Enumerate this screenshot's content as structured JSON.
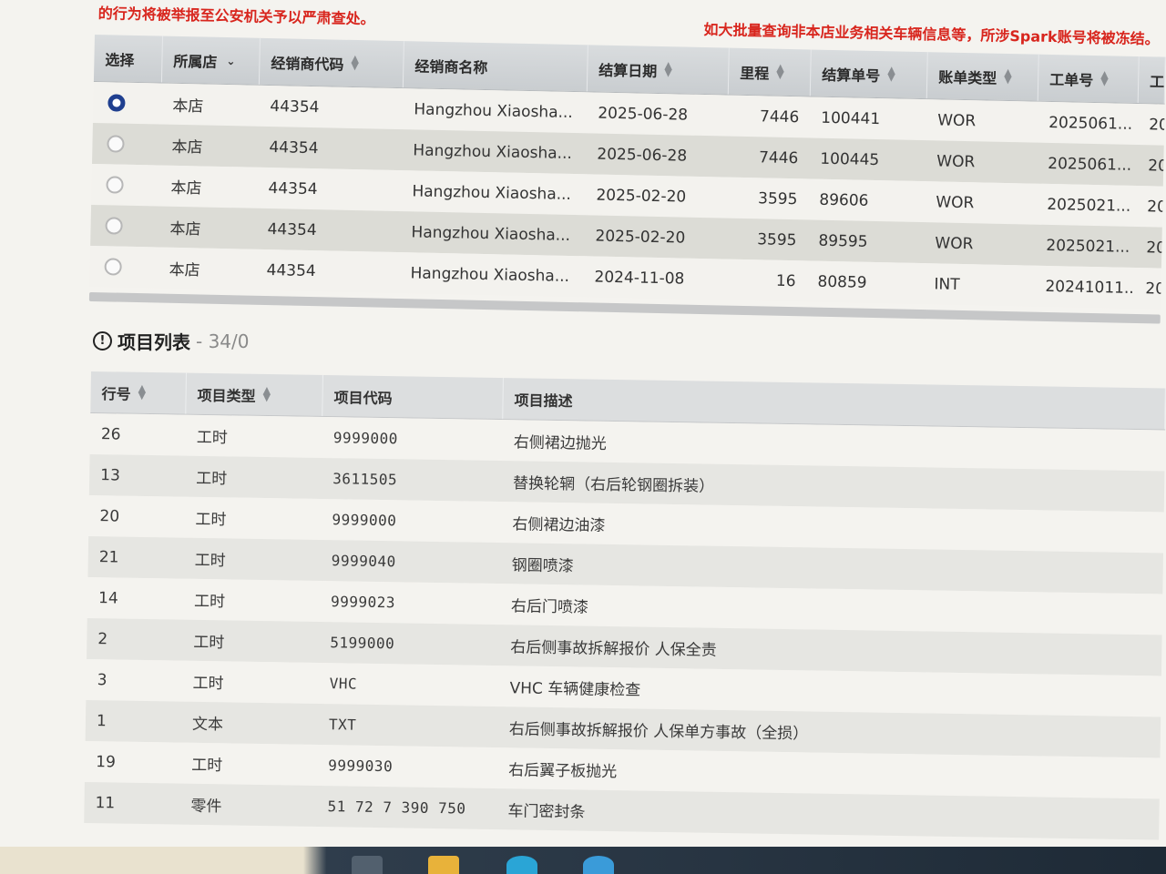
{
  "banner": {
    "warning_left": "的行为将被举报至公安机关予以严肃查处。",
    "warning_right": "如大批量查询非本店业务相关车辆信息等，所涉Spark账号将被冻结。"
  },
  "dealer_table": {
    "columns": [
      "选择",
      "所属店",
      "经销商代码",
      "经销商名称",
      "结算日期",
      "里程",
      "结算单号",
      "账单类型",
      "工单号",
      "工"
    ],
    "rows": [
      {
        "selected": true,
        "store": "本店",
        "code": "44354",
        "name": "Hangzhou Xiaosha...",
        "date": "2025-06-28",
        "mileage": "7446",
        "settle_no": "100441",
        "bill_type": "WOR",
        "order_no": "2025061...",
        "extra": "20"
      },
      {
        "selected": false,
        "store": "本店",
        "code": "44354",
        "name": "Hangzhou Xiaosha...",
        "date": "2025-06-28",
        "mileage": "7446",
        "settle_no": "100445",
        "bill_type": "WOR",
        "order_no": "2025061...",
        "extra": "20"
      },
      {
        "selected": false,
        "store": "本店",
        "code": "44354",
        "name": "Hangzhou Xiaosha...",
        "date": "2025-02-20",
        "mileage": "3595",
        "settle_no": "89606",
        "bill_type": "WOR",
        "order_no": "2025021...",
        "extra": "20"
      },
      {
        "selected": false,
        "store": "本店",
        "code": "44354",
        "name": "Hangzhou Xiaosha...",
        "date": "2025-02-20",
        "mileage": "3595",
        "settle_no": "89595",
        "bill_type": "WOR",
        "order_no": "2025021...",
        "extra": "20"
      },
      {
        "selected": false,
        "store": "本店",
        "code": "44354",
        "name": "Hangzhou Xiaosha...",
        "date": "2024-11-08",
        "mileage": "16",
        "settle_no": "80859",
        "bill_type": "INT",
        "order_no": "20241011...",
        "extra": "20"
      }
    ]
  },
  "items_section": {
    "title": "项目列表",
    "count": "- 34/0",
    "columns": [
      "行号",
      "项目类型",
      "项目代码",
      "项目描述"
    ],
    "rows": [
      {
        "line": "26",
        "type": "工时",
        "code": "9999000",
        "desc": "右侧裙边抛光"
      },
      {
        "line": "13",
        "type": "工时",
        "code": "3611505",
        "desc": "替换轮辋（右后轮钢圈拆装）"
      },
      {
        "line": "20",
        "type": "工时",
        "code": "9999000",
        "desc": "右侧裙边油漆"
      },
      {
        "line": "21",
        "type": "工时",
        "code": "9999040",
        "desc": "钢圈喷漆"
      },
      {
        "line": "14",
        "type": "工时",
        "code": "9999023",
        "desc": "右后门喷漆"
      },
      {
        "line": "2",
        "type": "工时",
        "code": "5199000",
        "desc": "右后侧事故拆解报价   人保全责"
      },
      {
        "line": "3",
        "type": "工时",
        "code": "VHC",
        "desc": "VHC 车辆健康检查"
      },
      {
        "line": "1",
        "type": "文本",
        "code": "TXT",
        "desc": "右后侧事故拆解报价   人保单方事故（全损）"
      },
      {
        "line": "19",
        "type": "工时",
        "code": "9999030",
        "desc": "右后翼子板抛光"
      },
      {
        "line": "11",
        "type": "零件",
        "code": "51 72 7 390 750",
        "desc": "车门密封条"
      }
    ]
  },
  "colors": {
    "warning": "#d8261e",
    "selected_radio": "#1f3f8f",
    "header_bg": "#d9dcde"
  }
}
